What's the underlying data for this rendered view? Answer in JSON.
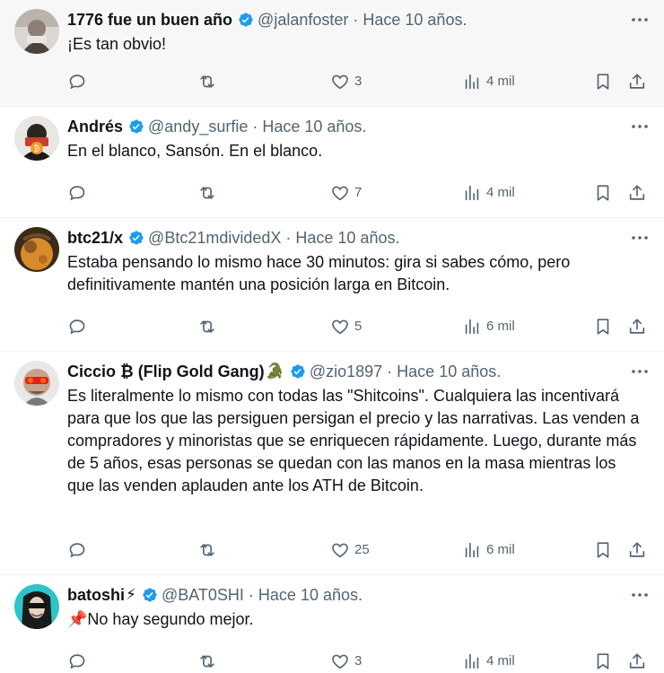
{
  "replies": [
    {
      "name": "1776 fue un buen año",
      "emoji": "",
      "handle": "@jalanfoster",
      "separator": "·",
      "time": "Hace 10 años.",
      "text": "¡Es tan obvio!",
      "likes": "3",
      "views": "4 mil",
      "hovered": true
    },
    {
      "name": "Andrés",
      "emoji": "",
      "handle": "@andy_surfie",
      "separator": "·",
      "time": "Hace 10 años.",
      "text": "En el blanco, Sansón. En el blanco.",
      "likes": "7",
      "views": "4 mil"
    },
    {
      "name": "btc21/x",
      "emoji": "",
      "handle": "@Btc21mdividedX",
      "separator": "·",
      "time": "Hace 10 años.",
      "text": "Estaba pensando lo mismo hace 30 minutos: gira si sabes cómo, pero definitivamente mantén una posición larga en Bitcoin.",
      "likes": "5",
      "views": "6 mil"
    },
    {
      "name": "Ciccio ₿ (Flip Gold Gang)",
      "emoji": "🐊",
      "handle": "@zio1897",
      "separator": "·",
      "time": "Hace 10 años.",
      "text": "Es literalmente lo mismo con todas las \"Shitcoins\". Cualquiera las incentivará para que los que las persiguen persigan el precio y las narrativas. Las venden a compradores y minoristas que se enriquecen rápidamente. Luego, durante más de 5 años, esas personas se quedan con las manos en la masa mientras los que las venden aplauden ante los ATH de Bitcoin.",
      "likes": "25",
      "views": "6 mil"
    },
    {
      "name": "batoshi",
      "emoji": "⚡",
      "handle": "@BAT0SHI",
      "separator": "·",
      "time": "Hace 10 años.",
      "text": "📌No hay segundo mejor.",
      "likes": "3",
      "views": "4 mil"
    }
  ],
  "icons": {
    "verified": "verified-badge-icon",
    "more": "more-dots-icon",
    "reply": "reply-bubble-icon",
    "repost": "repost-arrows-icon",
    "like": "heart-icon",
    "views": "views-bars-icon",
    "bookmark": "bookmark-icon",
    "share": "share-upload-icon"
  },
  "colors": {
    "text": "#0f1419",
    "secondary": "#536471",
    "verified": "#1d9bf0",
    "divider": "#eff3f4",
    "hover_background": "#f7f7f7"
  }
}
